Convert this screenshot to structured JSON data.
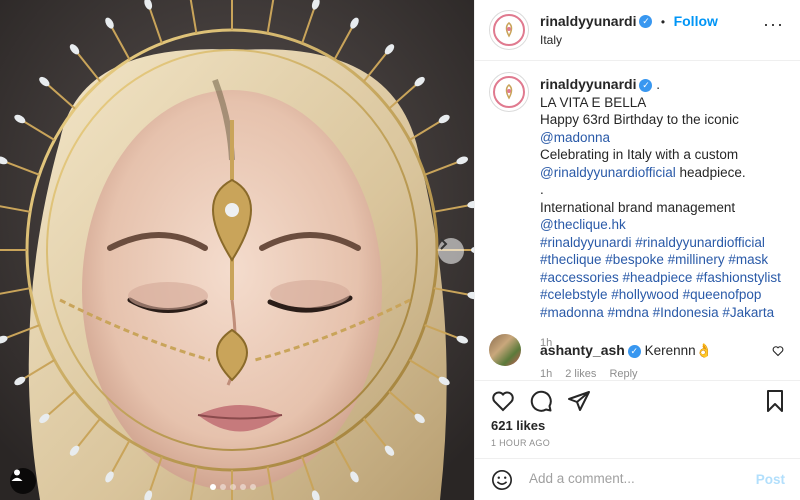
{
  "post": {
    "username": "rinaldyyunardi",
    "location": "Italy",
    "follow_label": "Follow",
    "separator": "•",
    "more_label": "···",
    "icons": {
      "verified": "verified-badge-icon",
      "more": "more-options-icon",
      "carousel_next": "chevron-right-icon",
      "tag": "user-tag-icon"
    }
  },
  "caption": {
    "username": "rinaldyyunardi",
    "trailing": ".",
    "lines": [
      {
        "text": "LA VITA E BELLA",
        "style": "plain"
      },
      {
        "text": "Happy 63rd Birthday to the iconic",
        "style": "plain"
      },
      {
        "text": "@madonna",
        "style": "link"
      },
      {
        "text": "Celebrating in Italy with a custom",
        "style": "plain"
      },
      {
        "text": "@rinaldyyunardiofficial",
        "style": "link",
        "suffix": " headpiece."
      },
      {
        "text": ".",
        "style": "plain"
      },
      {
        "text": "International brand management",
        "style": "plain"
      },
      {
        "text": "@theclique.hk",
        "style": "link"
      },
      {
        "text": "#rinaldyyunardi #rinaldyyunardiofficial",
        "style": "link"
      },
      {
        "text": "#theclique #bespoke #millinery #mask",
        "style": "link"
      },
      {
        "text": "#accessories #headpiece #fashionstylist",
        "style": "link"
      },
      {
        "text": "#celebstyle #hollywood #queenofpop",
        "style": "link"
      },
      {
        "text": "#madonna #mdna #Indonesia #Jakarta",
        "style": "link"
      }
    ],
    "time": "1h"
  },
  "comment": {
    "username": "ashanty_ash",
    "text": "Kerennn👌",
    "time": "1h",
    "likes": "2 likes",
    "reply_label": "Reply"
  },
  "actions": {
    "icons": [
      "heart-icon",
      "comment-icon",
      "share-icon",
      "bookmark-icon"
    ]
  },
  "likes": "621 likes",
  "posted_ago": "1 HOUR AGO",
  "add_comment": {
    "placeholder": "Add a comment...",
    "post_label": "Post"
  },
  "colors": {
    "link": "#2a5aa8",
    "follow": "#0095f6",
    "verified": "#3897f0",
    "post_disabled": "#b2dffc",
    "photo_gold": "#c9a45a"
  },
  "carousel": {
    "count": 5,
    "active_index": 0
  }
}
